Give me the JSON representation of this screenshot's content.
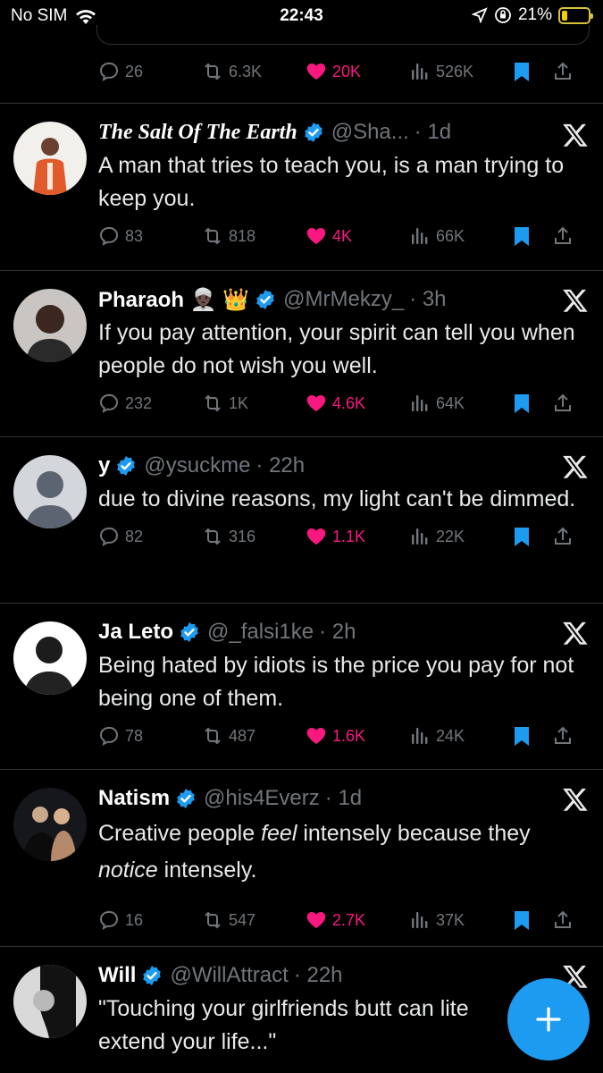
{
  "status_bar": {
    "carrier": "No SIM",
    "time": "22:43",
    "battery": "21%",
    "battery_level": 0.21
  },
  "colors": {
    "background": "#000000",
    "like": "#f91880",
    "accent": "#1d9bf0",
    "muted": "#71767b",
    "divider": "#2f3336"
  },
  "top_partial": {
    "replies": "26",
    "reposts": "6.3K",
    "likes": "20K",
    "views": "526K"
  },
  "tweets": [
    {
      "name": "The Salt Of The Earth",
      "handle": "@Sha...",
      "time": "· 1d",
      "text": "A man that tries to teach you, is a man trying to keep you.",
      "replies": "83",
      "reposts": "818",
      "likes": "4K",
      "views": "66K"
    },
    {
      "name": "Pharaoh 👳🏿‍♂️ 👑",
      "handle": "@MrMekzy_",
      "time": "· 3h",
      "text": "If you pay attention, your spirit can tell you when people do not wish you well.",
      "replies": "232",
      "reposts": "1K",
      "likes": "4.6K",
      "views": "64K"
    },
    {
      "name": "y",
      "handle": "@ysuckme",
      "time": "· 22h",
      "text": "due to divine reasons, my light can't be dimmed.",
      "replies": "82",
      "reposts": "316",
      "likes": "1.1K",
      "views": "22K"
    },
    {
      "name": "Ja Leto",
      "handle": "@_falsi1ke",
      "time": "· 2h",
      "text": "Being hated by idiots is the price you pay for not being one of them.",
      "replies": "78",
      "reposts": "487",
      "likes": "1.6K",
      "views": "24K"
    },
    {
      "name": "Natism",
      "handle": "@his4Everz",
      "time": "· 1d",
      "text_parts": [
        "Creative people ",
        "feel",
        " intensely because they ",
        "notice",
        " intensely."
      ],
      "replies": "16",
      "reposts": "547",
      "likes": "2.7K",
      "views": "37K"
    },
    {
      "name": "Will",
      "handle": "@WillAttract",
      "time": "· 22h",
      "text": "\"Touching your girlfriends butt can lite extend your life...\""
    }
  ],
  "icons": {
    "reply": "reply-icon",
    "repost": "repost-icon",
    "like": "heart-icon",
    "views": "views-icon",
    "bookmark": "bookmark-icon",
    "share": "share-icon",
    "source": "x-logo-icon",
    "compose": "plus-icon"
  }
}
